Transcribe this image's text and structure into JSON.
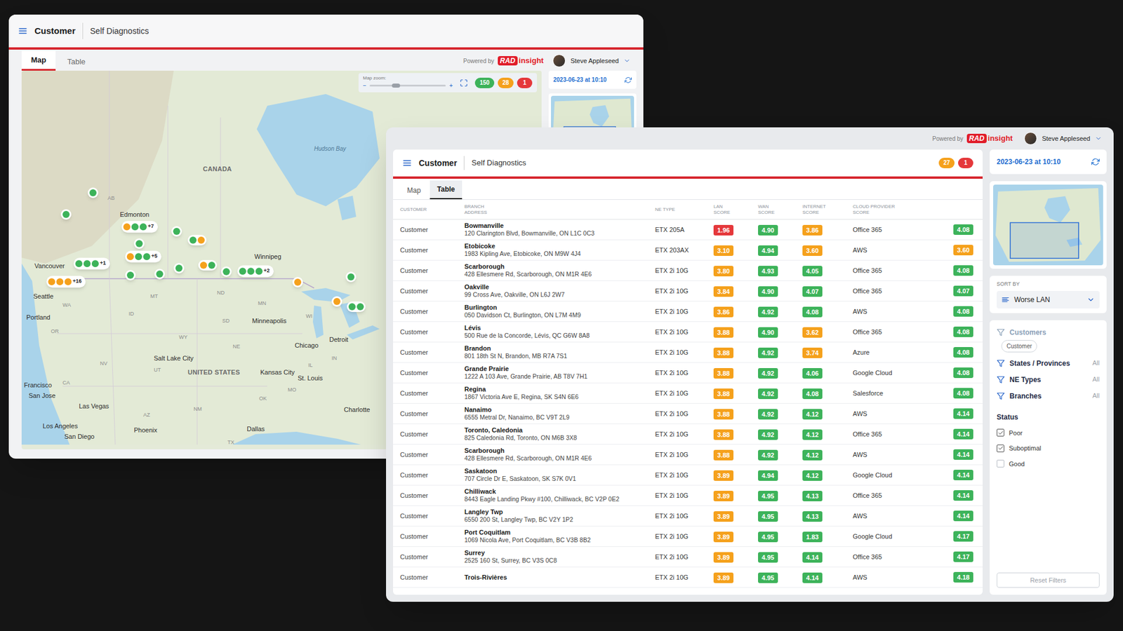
{
  "map_window": {
    "app_title": "Customer",
    "page_title": "Self Diagnostics",
    "powered_by": "Powered by",
    "logo_mark": "RAD",
    "logo_text": "insight",
    "user": "Steve Appleseed",
    "tabs": [
      {
        "label": "Map",
        "selected": true
      },
      {
        "label": "Table",
        "selected": false
      }
    ],
    "zoom": {
      "label": "Map zoom:",
      "minus": "−",
      "plus": "+",
      "level": 0.29
    },
    "status_counts": [
      {
        "count": "150",
        "color": "#3db35a"
      },
      {
        "count": "28",
        "color": "#f5a11c"
      },
      {
        "count": "1",
        "color": "#e5383b"
      }
    ],
    "updated": "2023-06-23 at 10:10",
    "map_labels": [
      {
        "text": "CANADA",
        "kind": "country"
      },
      {
        "text": "Hudson Bay",
        "kind": "water"
      },
      {
        "text": "Edmonton",
        "kind": "city"
      },
      {
        "text": "Vancouver",
        "kind": "city"
      },
      {
        "text": "Seattle",
        "kind": "city"
      },
      {
        "text": "Portland",
        "kind": "city"
      },
      {
        "text": "Winnipeg",
        "kind": "city"
      },
      {
        "text": "Minneapolis",
        "kind": "city"
      },
      {
        "text": "Chicago",
        "kind": "city"
      },
      {
        "text": "Detroit",
        "kind": "city"
      },
      {
        "text": "Salt Lake City",
        "kind": "city"
      },
      {
        "text": "UNITED STATES",
        "kind": "country"
      },
      {
        "text": "Kansas City",
        "kind": "city"
      },
      {
        "text": "St. Louis",
        "kind": "city"
      },
      {
        "text": "Francisco",
        "kind": "city"
      },
      {
        "text": "San Jose",
        "kind": "city"
      },
      {
        "text": "Las Vegas",
        "kind": "city"
      },
      {
        "text": "Los Angeles",
        "kind": "city"
      },
      {
        "text": "San Diego",
        "kind": "city"
      },
      {
        "text": "Phoenix",
        "kind": "city"
      },
      {
        "text": "Dallas",
        "kind": "city"
      },
      {
        "text": "Charlotte",
        "kind": "city"
      },
      {
        "text": "AB",
        "kind": "region"
      },
      {
        "text": "MT",
        "kind": "region"
      },
      {
        "text": "ND",
        "kind": "region"
      },
      {
        "text": "MN",
        "kind": "region"
      },
      {
        "text": "WI",
        "kind": "region"
      },
      {
        "text": "ID",
        "kind": "region"
      },
      {
        "text": "WY",
        "kind": "region"
      },
      {
        "text": "SD",
        "kind": "region"
      },
      {
        "text": "NE",
        "kind": "region"
      },
      {
        "text": "NV",
        "kind": "region"
      },
      {
        "text": "UT",
        "kind": "region"
      },
      {
        "text": "CA",
        "kind": "region"
      },
      {
        "text": "AZ",
        "kind": "region"
      },
      {
        "text": "NM",
        "kind": "region"
      },
      {
        "text": "OK",
        "kind": "region"
      },
      {
        "text": "TX",
        "kind": "region"
      },
      {
        "text": "IL",
        "kind": "region"
      },
      {
        "text": "IN",
        "kind": "region"
      },
      {
        "text": "MO",
        "kind": "region"
      },
      {
        "text": "WA",
        "kind": "region"
      },
      {
        "text": "OR",
        "kind": "region"
      }
    ],
    "pins": [
      {
        "dots": [
          "#3db35a"
        ]
      },
      {
        "dots": [
          "#3db35a"
        ]
      },
      {
        "dots": [
          "#f5a11c",
          "#3db35a",
          "#3db35a"
        ],
        "more": "+7"
      },
      {
        "dots": [
          "#3db35a"
        ]
      },
      {
        "dots": [
          "#3db35a",
          "#f5a11c"
        ]
      },
      {
        "dots": [
          "#3db35a"
        ]
      },
      {
        "dots": [
          "#f5a11c",
          "#3db35a",
          "#3db35a"
        ],
        "more": "+5"
      },
      {
        "dots": [
          "#3db35a",
          "#3db35a",
          "#3db35a"
        ],
        "more": "+1"
      },
      {
        "dots": [
          "#3db35a"
        ]
      },
      {
        "dots": [
          "#3db35a"
        ]
      },
      {
        "dots": [
          "#3db35a"
        ]
      },
      {
        "dots": [
          "#f5a11c",
          "#3db35a"
        ]
      },
      {
        "dots": [
          "#3db35a"
        ]
      },
      {
        "dots": [
          "#3db35a",
          "#3db35a",
          "#3db35a"
        ],
        "more": "+2"
      },
      {
        "dots": [
          "#f5a11c",
          "#f5a11c",
          "#f5a11c"
        ],
        "more": "+16"
      },
      {
        "dots": [
          "#3db35a"
        ]
      },
      {
        "dots": [
          "#f5a11c"
        ]
      },
      {
        "dots": [
          "#f5a11c"
        ]
      },
      {
        "dots": [
          "#3db35a",
          "#3db35a"
        ]
      }
    ]
  },
  "table_window": {
    "app_title": "Customer",
    "page_title": "Self Diagnostics",
    "powered_by": "Powered by",
    "logo_mark": "RAD",
    "logo_text": "insight",
    "user": "Steve Appleseed",
    "status_counts": [
      {
        "count": "27",
        "color": "#f5a11c"
      },
      {
        "count": "1",
        "color": "#e5383b"
      }
    ],
    "tabs": [
      {
        "label": "Map",
        "selected": false
      },
      {
        "label": "Table",
        "selected": true
      }
    ],
    "table": {
      "columns": [
        {
          "lines": [
            "CUSTOMER"
          ]
        },
        {
          "lines": [
            "BRANCH",
            "ADDRESS"
          ]
        },
        {
          "lines": [
            "NE TYPE"
          ]
        },
        {
          "lines": [
            "LAN",
            "SCORE"
          ]
        },
        {
          "lines": [
            "WAN",
            "SCORE"
          ]
        },
        {
          "lines": [
            "INTERNET",
            "SCORE"
          ]
        },
        {
          "lines": [
            "CLOUD PROVIDER",
            "SCORE"
          ]
        }
      ],
      "rows": [
        {
          "customer": "Customer",
          "branch": "Bowmanville",
          "address": "120 Clarington Blvd, Bowmanville, ON L1C 0C3",
          "ne_type": "ETX 205A",
          "lan": {
            "value": "1.96",
            "color": "#e5383b"
          },
          "wan": {
            "value": "4.90",
            "color": "#3db35a"
          },
          "internet": {
            "value": "3.86",
            "color": "#f5a11c"
          },
          "provider": "Office 365",
          "provider_score": {
            "value": "4.08",
            "color": "#3db35a"
          }
        },
        {
          "customer": "Customer",
          "branch": "Etobicoke",
          "address": "1983 Kipling Ave, Etobicoke, ON M9W 4J4",
          "ne_type": "ETX 203AX",
          "lan": {
            "value": "3.10",
            "color": "#f5a11c"
          },
          "wan": {
            "value": "4.94",
            "color": "#3db35a"
          },
          "internet": {
            "value": "3.60",
            "color": "#f5a11c"
          },
          "provider": "AWS",
          "provider_score": {
            "value": "3.60",
            "color": "#f5a11c"
          }
        },
        {
          "customer": "Customer",
          "branch": "Scarborough",
          "address": "428 Ellesmere Rd, Scarborough, ON M1R 4E6",
          "ne_type": "ETX 2i 10G",
          "lan": {
            "value": "3.80",
            "color": "#f5a11c"
          },
          "wan": {
            "value": "4.93",
            "color": "#3db35a"
          },
          "internet": {
            "value": "4.05",
            "color": "#3db35a"
          },
          "provider": "Office 365",
          "provider_score": {
            "value": "4.08",
            "color": "#3db35a"
          }
        },
        {
          "customer": "Customer",
          "branch": "Oakville",
          "address": "99 Cross Ave, Oakville, ON L6J 2W7",
          "ne_type": "ETX 2i 10G",
          "lan": {
            "value": "3.84",
            "color": "#f5a11c"
          },
          "wan": {
            "value": "4.90",
            "color": "#3db35a"
          },
          "internet": {
            "value": "4.07",
            "color": "#3db35a"
          },
          "provider": "Office 365",
          "provider_score": {
            "value": "4.07",
            "color": "#3db35a"
          }
        },
        {
          "customer": "Customer",
          "branch": "Burlington",
          "address": "050 Davidson Ct, Burlington, ON L7M 4M9",
          "ne_type": "ETX 2i 10G",
          "lan": {
            "value": "3.86",
            "color": "#f5a11c"
          },
          "wan": {
            "value": "4.92",
            "color": "#3db35a"
          },
          "internet": {
            "value": "4.08",
            "color": "#3db35a"
          },
          "provider": "AWS",
          "provider_score": {
            "value": "4.08",
            "color": "#3db35a"
          }
        },
        {
          "customer": "Customer",
          "branch": "Lévis",
          "address": "500 Rue de la Concorde, Lévis, QC G6W 8A8",
          "ne_type": "ETX 2i 10G",
          "lan": {
            "value": "3.88",
            "color": "#f5a11c"
          },
          "wan": {
            "value": "4.90",
            "color": "#3db35a"
          },
          "internet": {
            "value": "3.62",
            "color": "#f5a11c"
          },
          "provider": "Office 365",
          "provider_score": {
            "value": "4.08",
            "color": "#3db35a"
          }
        },
        {
          "customer": "Customer",
          "branch": "Brandon",
          "address": "801 18th St N, Brandon, MB R7A 7S1",
          "ne_type": "ETX 2i 10G",
          "lan": {
            "value": "3.88",
            "color": "#f5a11c"
          },
          "wan": {
            "value": "4.92",
            "color": "#3db35a"
          },
          "internet": {
            "value": "3.74",
            "color": "#f5a11c"
          },
          "provider": "Azure",
          "provider_score": {
            "value": "4.08",
            "color": "#3db35a"
          }
        },
        {
          "customer": "Customer",
          "branch": "Grande Prairie",
          "address": "1222 A 103 Ave, Grande Prairie, AB T8V 7H1",
          "ne_type": "ETX 2i 10G",
          "lan": {
            "value": "3.88",
            "color": "#f5a11c"
          },
          "wan": {
            "value": "4.92",
            "color": "#3db35a"
          },
          "internet": {
            "value": "4.06",
            "color": "#3db35a"
          },
          "provider": "Google Cloud",
          "provider_score": {
            "value": "4.08",
            "color": "#3db35a"
          }
        },
        {
          "customer": "Customer",
          "branch": "Regina",
          "address": "1867 Victoria Ave E, Regina, SK S4N 6E6",
          "ne_type": "ETX 2i 10G",
          "lan": {
            "value": "3.88",
            "color": "#f5a11c"
          },
          "wan": {
            "value": "4.92",
            "color": "#3db35a"
          },
          "internet": {
            "value": "4.08",
            "color": "#3db35a"
          },
          "provider": "Salesforce",
          "provider_score": {
            "value": "4.08",
            "color": "#3db35a"
          }
        },
        {
          "customer": "Customer",
          "branch": "Nanaimo",
          "address": "6555 Metral Dr, Nanaimo, BC V9T 2L9",
          "ne_type": "ETX 2i 10G",
          "lan": {
            "value": "3.88",
            "color": "#f5a11c"
          },
          "wan": {
            "value": "4.92",
            "color": "#3db35a"
          },
          "internet": {
            "value": "4.12",
            "color": "#3db35a"
          },
          "provider": "AWS",
          "provider_score": {
            "value": "4.14",
            "color": "#3db35a"
          }
        },
        {
          "customer": "Customer",
          "branch": "Toronto, Caledonia",
          "address": "825 Caledonia Rd, Toronto, ON M6B 3X8",
          "ne_type": "ETX 2i 10G",
          "lan": {
            "value": "3.88",
            "color": "#f5a11c"
          },
          "wan": {
            "value": "4.92",
            "color": "#3db35a"
          },
          "internet": {
            "value": "4.12",
            "color": "#3db35a"
          },
          "provider": "Office 365",
          "provider_score": {
            "value": "4.14",
            "color": "#3db35a"
          }
        },
        {
          "customer": "Customer",
          "branch": "Scarborough",
          "address": "428 Ellesmere Rd, Scarborough, ON M1R 4E6",
          "ne_type": "ETX 2i 10G",
          "lan": {
            "value": "3.88",
            "color": "#f5a11c"
          },
          "wan": {
            "value": "4.92",
            "color": "#3db35a"
          },
          "internet": {
            "value": "4.12",
            "color": "#3db35a"
          },
          "provider": "AWS",
          "provider_score": {
            "value": "4.14",
            "color": "#3db35a"
          }
        },
        {
          "customer": "Customer",
          "branch": "Saskatoon",
          "address": "707 Circle Dr E, Saskatoon, SK S7K 0V1",
          "ne_type": "ETX 2i 10G",
          "lan": {
            "value": "3.89",
            "color": "#f5a11c"
          },
          "wan": {
            "value": "4.94",
            "color": "#3db35a"
          },
          "internet": {
            "value": "4.12",
            "color": "#3db35a"
          },
          "provider": "Google Cloud",
          "provider_score": {
            "value": "4.14",
            "color": "#3db35a"
          }
        },
        {
          "customer": "Customer",
          "branch": "Chilliwack",
          "address": "8443 Eagle Landing Pkwy #100, Chilliwack, BC V2P 0E2",
          "ne_type": "ETX 2i 10G",
          "lan": {
            "value": "3.89",
            "color": "#f5a11c"
          },
          "wan": {
            "value": "4.95",
            "color": "#3db35a"
          },
          "internet": {
            "value": "4.13",
            "color": "#3db35a"
          },
          "provider": "Office 365",
          "provider_score": {
            "value": "4.14",
            "color": "#3db35a"
          }
        },
        {
          "customer": "Customer",
          "branch": "Langley Twp",
          "address": "6550 200 St, Langley Twp, BC V2Y 1P2",
          "ne_type": "ETX 2i 10G",
          "lan": {
            "value": "3.89",
            "color": "#f5a11c"
          },
          "wan": {
            "value": "4.95",
            "color": "#3db35a"
          },
          "internet": {
            "value": "4.13",
            "color": "#3db35a"
          },
          "provider": "AWS",
          "provider_score": {
            "value": "4.14",
            "color": "#3db35a"
          }
        },
        {
          "customer": "Customer",
          "branch": "Port Coquitlam",
          "address": "1069 Nicola Ave, Port Coquitlam, BC V3B 8B2",
          "ne_type": "ETX 2i 10G",
          "lan": {
            "value": "3.89",
            "color": "#f5a11c"
          },
          "wan": {
            "value": "4.95",
            "color": "#3db35a"
          },
          "internet": {
            "value": "1.83",
            "color": "#3db35a"
          },
          "provider": "Google Cloud",
          "provider_score": {
            "value": "4.17",
            "color": "#3db35a"
          }
        },
        {
          "customer": "Customer",
          "branch": "Surrey",
          "address": "2525 160 St, Surrey, BC V3S 0C8",
          "ne_type": "ETX 2i 10G",
          "lan": {
            "value": "3.89",
            "color": "#f5a11c"
          },
          "wan": {
            "value": "4.95",
            "color": "#3db35a"
          },
          "internet": {
            "value": "4.14",
            "color": "#3db35a"
          },
          "provider": "Office 365",
          "provider_score": {
            "value": "4.17",
            "color": "#3db35a"
          }
        },
        {
          "customer": "Customer",
          "branch": "Trois-Rivières",
          "ne_type": "ETX 2i 10G",
          "lan": {
            "value": "3.89",
            "color": "#f5a11c"
          },
          "wan": {
            "value": "4.95",
            "color": "#3db35a"
          },
          "internet": {
            "value": "4.14",
            "color": "#3db35a"
          },
          "provider": "AWS",
          "provider_score": {
            "value": "4.18",
            "color": "#3db35a"
          }
        }
      ]
    },
    "side": {
      "updated": "2023-06-23 at 10:10",
      "sort": {
        "label": "SORT BY",
        "value": "Worse LAN"
      },
      "filters": [
        {
          "label": "Customers",
          "chips": [
            "Customer"
          ]
        },
        {
          "label": "States / Provinces",
          "value": "All"
        },
        {
          "label": "NE Types",
          "value": "All"
        },
        {
          "label": "Branches",
          "value": "All"
        }
      ],
      "status": {
        "label": "Status",
        "options": [
          {
            "label": "Poor",
            "checked": true
          },
          {
            "label": "Suboptimal",
            "checked": true
          },
          {
            "label": "Good",
            "checked": false
          }
        ]
      },
      "reset": {
        "label": "Reset Filters",
        "disabled": true
      }
    }
  }
}
